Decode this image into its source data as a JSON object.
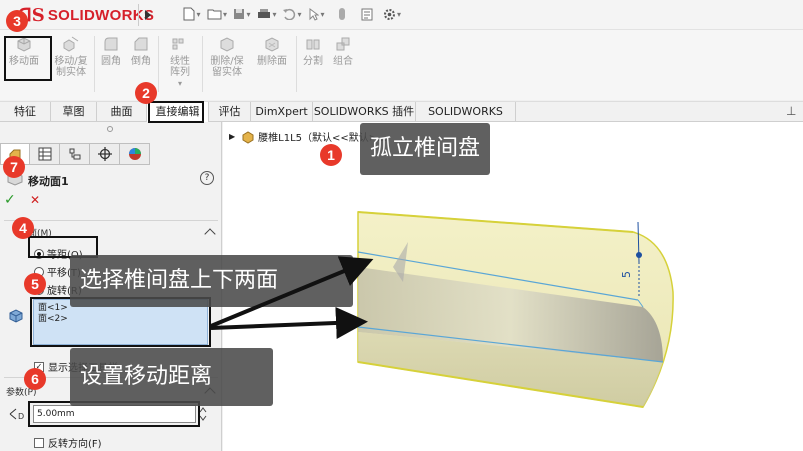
{
  "app": {
    "logo_prefix": "3S",
    "logo_text": "SOLIDWORKS"
  },
  "ribbon": {
    "buttons": [
      {
        "label": "移动面"
      },
      {
        "label": "移动/复制实体"
      },
      {
        "label": "圆角"
      },
      {
        "label": "倒角"
      },
      {
        "label": "线性阵列"
      },
      {
        "label": "删除/保留实体"
      },
      {
        "label": "删除面"
      },
      {
        "label": "分割"
      },
      {
        "label": "组合"
      }
    ]
  },
  "tabs": [
    "特征",
    "草图",
    "曲面",
    "直接编辑",
    "评估",
    "DimXpert",
    "SOLIDWORKS 插件",
    "SOLIDWORKS MBD"
  ],
  "panel": {
    "title": "移动面1",
    "help": "?",
    "group1_label": "面(M)",
    "options": [
      "等距(O)",
      "平移(T)",
      "旋转(R)"
    ],
    "faces": [
      "面<1>",
      "面<2>"
    ],
    "show_toolbar": "显示选择工具栏",
    "params_label": "参数(P)",
    "distance": "5.00mm",
    "reverse": "反转方向(F)"
  },
  "viewport": {
    "tree_node": "腰椎L1L5（默认<<默认>...",
    "dimension": "5"
  },
  "annotations": {
    "n1": "1",
    "n2": "2",
    "n3": "3",
    "n4": "4",
    "n5": "5",
    "n6": "6",
    "n7": "7",
    "c1": "孤立椎间盘",
    "c5": "选择椎间盘上下两面",
    "c6": "设置移动距离"
  },
  "colors": {
    "brand": "#d6202a",
    "marker": "#e8392a",
    "selection": "#cfe2f5",
    "ok": "#2a9a2a",
    "cancel": "#d02020"
  }
}
